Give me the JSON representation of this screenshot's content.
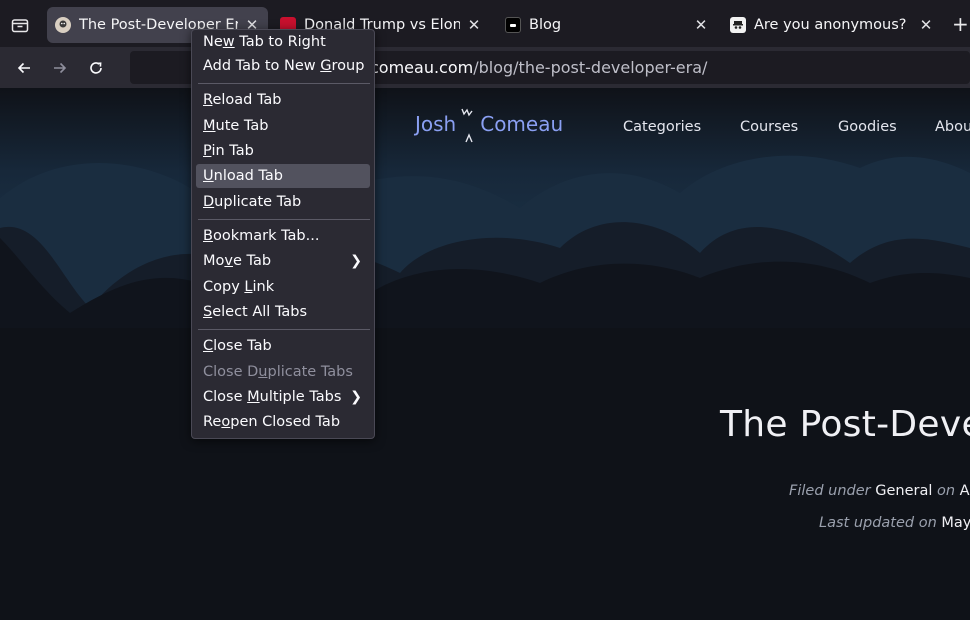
{
  "tabs": [
    {
      "title": "The Post-Developer Era",
      "favicon": "penguin-avatar-icon",
      "active": true
    },
    {
      "title": "Donald Trump vs Elon Musk",
      "favicon": "red-news-icon",
      "active": false
    },
    {
      "title": "Blog",
      "favicon": "dark-square-icon",
      "active": false
    },
    {
      "title": "Are you anonymous?",
      "favicon": "spy-face-icon",
      "active": false
    }
  ],
  "url": {
    "domain": "joshwcomeau.com",
    "path": "/blog/the-post-developer-era/",
    "visible_prefix": "comeau.com"
  },
  "context_menu": {
    "items": [
      {
        "pre": "Ne",
        "acc": "w",
        "post": " Tab to Right"
      },
      {
        "pre": "Add Tab to New ",
        "acc": "G",
        "post": "roup"
      },
      {
        "pre": "",
        "acc": "R",
        "post": "eload Tab"
      },
      {
        "pre": "",
        "acc": "M",
        "post": "ute Tab"
      },
      {
        "pre": "",
        "acc": "P",
        "post": "in Tab"
      },
      {
        "pre": "",
        "acc": "U",
        "post": "nload Tab"
      },
      {
        "pre": "",
        "acc": "D",
        "post": "uplicate Tab"
      },
      {
        "pre": "",
        "acc": "B",
        "post": "ookmark Tab..."
      },
      {
        "pre": "Mo",
        "acc": "v",
        "post": "e Tab"
      },
      {
        "pre": "Copy ",
        "acc": "L",
        "post": "ink"
      },
      {
        "pre": "",
        "acc": "S",
        "post": "elect All Tabs"
      },
      {
        "pre": "",
        "acc": "C",
        "post": "lose Tab"
      },
      {
        "pre": "Close D",
        "acc": "u",
        "post": "plicate Tabs"
      },
      {
        "pre": "Close ",
        "acc": "M",
        "post": "ultiple Tabs"
      },
      {
        "pre": "Re",
        "acc": "o",
        "post": "pen Closed Tab"
      }
    ],
    "hovered": "Unload Tab",
    "disabled": [
      "Close Duplicate Tabs"
    ],
    "submenus": [
      "Move Tab",
      "Close Multiple Tabs"
    ]
  },
  "site": {
    "logo_first": "Josh",
    "logo_last": "Comeau",
    "nav": [
      "Categories",
      "Courses",
      "Goodies",
      "About"
    ],
    "post_title": "The Post-Developer Era",
    "filed_under_label": "Filed under",
    "category": "General",
    "on_label": "on",
    "published": "Ap",
    "last_updated_label": "Last updated on",
    "updated": "May"
  },
  "colors": {
    "accent": "#8a9ff2",
    "menu_bg": "#2b2a33",
    "hover": "#52525e",
    "tab_active": "#42414d"
  }
}
